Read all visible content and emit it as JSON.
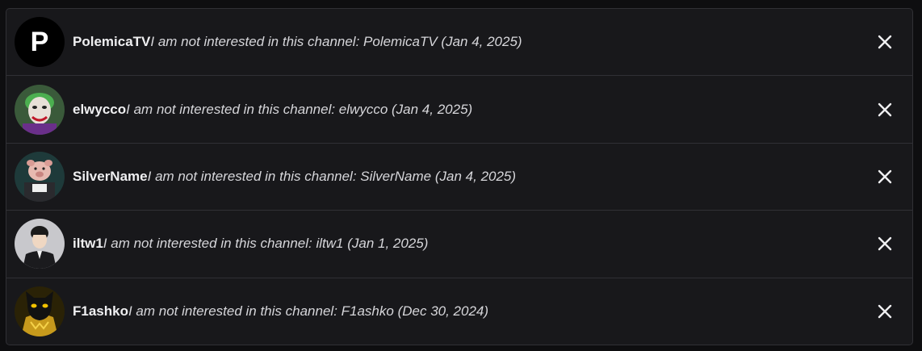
{
  "items": [
    {
      "name": "PolemicaTV",
      "reason": "I am not interested in this channel: PolemicaTV",
      "date": "(Jan 4, 2025)",
      "avatar_letter": "P",
      "avatar_icon": "letter-p-avatar"
    },
    {
      "name": "elwycco",
      "reason": "I am not interested in this channel: elwycco",
      "date": "(Jan 4, 2025)",
      "avatar_icon": "joker-avatar"
    },
    {
      "name": "SilverName",
      "reason": "I am not interested in this channel: SilverName",
      "date": "(Jan 4, 2025)",
      "avatar_icon": "pig-avatar"
    },
    {
      "name": "iltw1",
      "reason": "I am not interested in this channel: iltw1",
      "date": "(Jan 1, 2025)",
      "avatar_icon": "person-avatar"
    },
    {
      "name": "F1ashko",
      "reason": "I am not interested in this channel: F1ashko",
      "date": "(Dec 30, 2024)",
      "avatar_icon": "black-cat-avatar"
    }
  ],
  "close_icon": "close-icon"
}
